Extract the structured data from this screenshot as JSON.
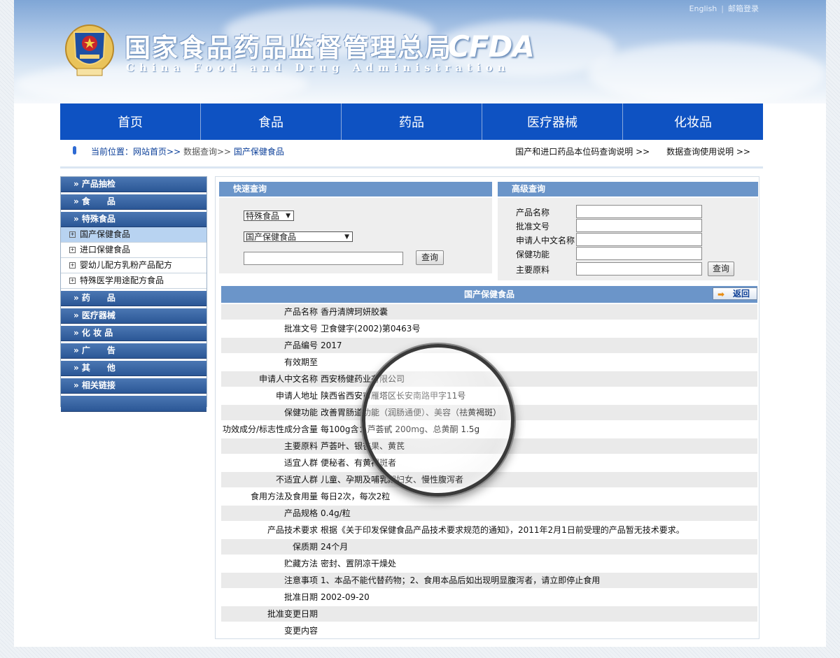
{
  "header": {
    "top_links": [
      "English",
      "邮箱登录"
    ],
    "title_cn": "国家食品药品监督管理总局",
    "title_en": "China Food and Drug Administration",
    "logo_text": "CFDA"
  },
  "nav": [
    "首页",
    "食品",
    "药品",
    "医疗器械",
    "化妆品"
  ],
  "breadcrumb": {
    "prefix": "当前位置：",
    "home": "网站首页>>",
    "query": "数据查询>>",
    "current": "国产保健食品",
    "links": [
      "国产和进口药品本位码查询说明 >>",
      "数据查询使用说明 >>"
    ]
  },
  "sidebar": {
    "head_product_check": "» 产品抽检",
    "head_food": "» 食　　品",
    "head_special": "» 特殊食品",
    "subs": [
      "国产保健食品",
      "进口保健食品",
      "婴幼儿配方乳粉产品配方",
      "特殊医学用途配方食品"
    ],
    "head_drug": "» 药　　品",
    "head_device": "» 医疗器械",
    "head_cosmetic": "» 化 妆 品",
    "head_ad": "» 广　　告",
    "head_other": "» 其　　他",
    "head_links": "» 相关链接"
  },
  "quick_search": {
    "title": "快速查询",
    "select1": "特殊食品",
    "select2": "国产保健食品",
    "button": "查询"
  },
  "advanced_search": {
    "title": "高级查询",
    "labels": [
      "产品名称",
      "批准文号",
      "申请人中文名称",
      "保健功能",
      "主要原料"
    ],
    "button": "查询"
  },
  "detail": {
    "title": "国产保健食品",
    "back": "返回",
    "rows": [
      {
        "label": "产品名称",
        "value": "香丹清牌珂妍胶囊"
      },
      {
        "label": "批准文号",
        "value": "卫食健字(2002)第0463号"
      },
      {
        "label": "产品编号",
        "value": "2017"
      },
      {
        "label": "有效期至",
        "value": ""
      },
      {
        "label": "申请人中文名称",
        "value": "西安杨健药业有限公司"
      },
      {
        "label": "申请人地址",
        "value": "陕西省西安市雁塔区长安南路甲字11号"
      },
      {
        "label": "保健功能",
        "value": "改善胃肠道功能（润肠通便）、美容（祛黄褐斑）"
      },
      {
        "label": "功效成分/标志性成分含量",
        "value": "每100g含：芦荟甙 200mg、总黄酮 1.5g"
      },
      {
        "label": "主要原料",
        "value": "芦荟叶、银杏果、黄芪"
      },
      {
        "label": "适宜人群",
        "value": "便秘者、有黄褐斑者"
      },
      {
        "label": "不适宜人群",
        "value": "儿童、孕期及哺乳期妇女、慢性腹泻者"
      },
      {
        "label": "食用方法及食用量",
        "value": "每日2次，每次2粒"
      },
      {
        "label": "产品规格",
        "value": "0.4g/粒"
      },
      {
        "label": "产品技术要求",
        "value": "根据《关于印发保健食品产品技术要求规范的通知》，2011年2月1日前受理的产品暂无技术要求。"
      },
      {
        "label": "保质期",
        "value": "24个月"
      },
      {
        "label": "贮藏方法",
        "value": "密封、置阴凉干燥处"
      },
      {
        "label": "注意事项",
        "value": "1、本品不能代替药物；2、食用本品后如出现明显腹泻者，请立即停止食用"
      },
      {
        "label": "批准日期",
        "value": "2002-09-20"
      },
      {
        "label": "批准变更日期",
        "value": ""
      },
      {
        "label": "变更内容",
        "value": ""
      }
    ]
  },
  "colors": {
    "nav": "#0e52c2",
    "panel_head": "#6b95c9",
    "sidebar_head": "#2b5796"
  }
}
